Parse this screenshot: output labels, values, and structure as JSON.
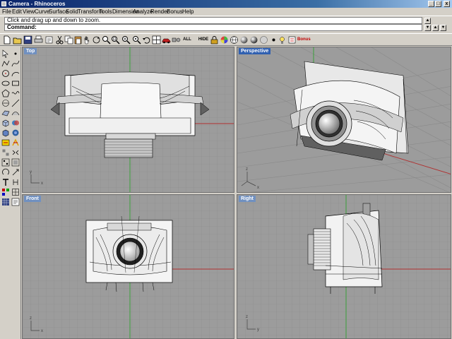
{
  "window": {
    "title": "Camera - Rhinoceros",
    "controls": [
      "_",
      "□",
      "x"
    ]
  },
  "menu": [
    "File",
    "Edit",
    "View",
    "Curve",
    "Surface",
    "Solid",
    "Transform",
    "Tools",
    "Dimension",
    "Analyze",
    "Render",
    "Bonus",
    "Help"
  ],
  "command": {
    "history": "Click and drag up and down to zoom.",
    "prompt_label": "Command:"
  },
  "toolbar": {
    "all_label": "ALL",
    "hide_label": "HIDE",
    "bonus_label": "Bonus"
  },
  "viewports": {
    "top": "Top",
    "perspective": "Perspective",
    "front": "Front",
    "right": "Right"
  },
  "axis": {
    "x": "x",
    "y": "y",
    "z": "z"
  },
  "colors": {
    "grid_bg": "#9c9c9c",
    "grid_line": "#8c8c8c",
    "x_axis": "#b03030",
    "y_axis": "#30a030",
    "label_bg": "#7090c0"
  }
}
